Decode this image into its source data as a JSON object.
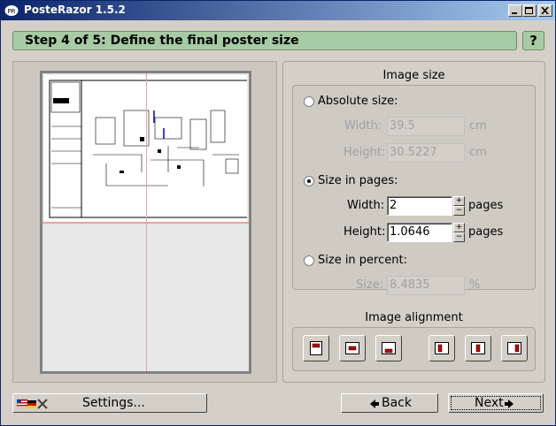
{
  "window": {
    "title": "PosteRazor 1.5.2"
  },
  "step": {
    "title": "Step 4 of 5: Define the final poster size",
    "help_label": "?"
  },
  "image_size": {
    "section_title": "Image size",
    "absolute": {
      "label": "Absolute size:",
      "checked": false,
      "width_label": "Width:",
      "width_value": "39.5",
      "width_unit": "cm",
      "height_label": "Height:",
      "height_value": "30.5227",
      "height_unit": "cm"
    },
    "pages": {
      "label": "Size in pages:",
      "checked": true,
      "width_label": "Width:",
      "width_value": "2",
      "width_unit": "pages",
      "height_label": "Height:",
      "height_value": "1.0646",
      "height_unit": "pages"
    },
    "percent": {
      "label": "Size in percent:",
      "checked": false,
      "size_label": "Size:",
      "size_value": "8.4835",
      "size_unit": "%"
    }
  },
  "image_alignment": {
    "section_title": "Image alignment"
  },
  "footer": {
    "settings_label": "Settings...",
    "back_label": "Back",
    "next_label": "Next"
  },
  "colors": {
    "header_green": "#a7cba4",
    "titlebar": "#0a246a",
    "grid_line": "#f0a0a0",
    "accent_red": "#c00000"
  }
}
